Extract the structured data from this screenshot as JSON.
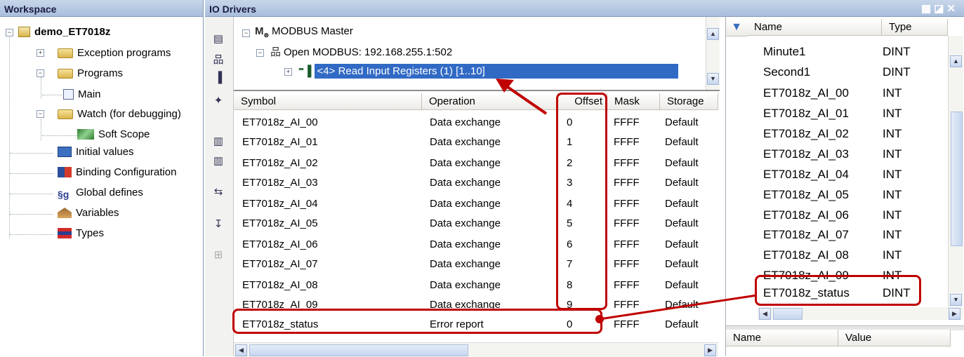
{
  "workspace": {
    "title": "Workspace",
    "project": "demo_ET7018z",
    "items": [
      {
        "label": "Exception programs"
      },
      {
        "label": "Programs"
      },
      {
        "label": "Main"
      },
      {
        "label": "Watch (for debugging)"
      },
      {
        "label": "Soft Scope"
      },
      {
        "label": "Initial values"
      },
      {
        "label": "Binding Configuration"
      },
      {
        "label": "Global defines"
      },
      {
        "label": "Variables"
      },
      {
        "label": "Types"
      }
    ]
  },
  "io": {
    "title": "IO Drivers",
    "tree": {
      "master": "MODBUS Master",
      "open": "Open MODBUS: 192.168.255.1:502",
      "read": "<4> Read Input Registers (1) [1..10]"
    },
    "columns": {
      "symbol": "Symbol",
      "operation": "Operation",
      "offset": "Offset",
      "mask": "Mask",
      "storage": "Storage"
    },
    "rows": [
      {
        "symbol": "ET7018z_AI_00",
        "operation": "Data exchange",
        "offset": "0",
        "mask": "FFFF",
        "storage": "Default"
      },
      {
        "symbol": "ET7018z_AI_01",
        "operation": "Data exchange",
        "offset": "1",
        "mask": "FFFF",
        "storage": "Default"
      },
      {
        "symbol": "ET7018z_AI_02",
        "operation": "Data exchange",
        "offset": "2",
        "mask": "FFFF",
        "storage": "Default"
      },
      {
        "symbol": "ET7018z_AI_03",
        "operation": "Data exchange",
        "offset": "3",
        "mask": "FFFF",
        "storage": "Default"
      },
      {
        "symbol": "ET7018z_AI_04",
        "operation": "Data exchange",
        "offset": "4",
        "mask": "FFFF",
        "storage": "Default"
      },
      {
        "symbol": "ET7018z_AI_05",
        "operation": "Data exchange",
        "offset": "5",
        "mask": "FFFF",
        "storage": "Default"
      },
      {
        "symbol": "ET7018z_AI_06",
        "operation": "Data exchange",
        "offset": "6",
        "mask": "FFFF",
        "storage": "Default"
      },
      {
        "symbol": "ET7018z_AI_07",
        "operation": "Data exchange",
        "offset": "7",
        "mask": "FFFF",
        "storage": "Default"
      },
      {
        "symbol": "ET7018z_AI_08",
        "operation": "Data exchange",
        "offset": "8",
        "mask": "FFFF",
        "storage": "Default"
      },
      {
        "symbol": "ET7018z_AI_09",
        "operation": "Data exchange",
        "offset": "9",
        "mask": "FFFF",
        "storage": "Default"
      },
      {
        "symbol": "ET7018z_status",
        "operation": "Error report",
        "offset": "0",
        "mask": "FFFF",
        "storage": "Default"
      }
    ]
  },
  "vars": {
    "col_name": "Name",
    "col_type": "Type",
    "rows": [
      {
        "name": "Minute1",
        "type": "DINT"
      },
      {
        "name": "Second1",
        "type": "DINT"
      },
      {
        "name": "ET7018z_AI_00",
        "type": "INT"
      },
      {
        "name": "ET7018z_AI_01",
        "type": "INT"
      },
      {
        "name": "ET7018z_AI_02",
        "type": "INT"
      },
      {
        "name": "ET7018z_AI_03",
        "type": "INT"
      },
      {
        "name": "ET7018z_AI_04",
        "type": "INT"
      },
      {
        "name": "ET7018z_AI_05",
        "type": "INT"
      },
      {
        "name": "ET7018z_AI_06",
        "type": "INT"
      },
      {
        "name": "ET7018z_AI_07",
        "type": "INT"
      },
      {
        "name": "ET7018z_AI_08",
        "type": "INT"
      },
      {
        "name": "ET7018z_AI_09",
        "type": "INT"
      },
      {
        "name": "ET7018z_status",
        "type": "DINT"
      }
    ],
    "bottom_name": "Name",
    "bottom_value": "Value"
  },
  "colors": {
    "highlight": "#c00000",
    "selection": "#316ac5",
    "header": "#a9bedc"
  }
}
